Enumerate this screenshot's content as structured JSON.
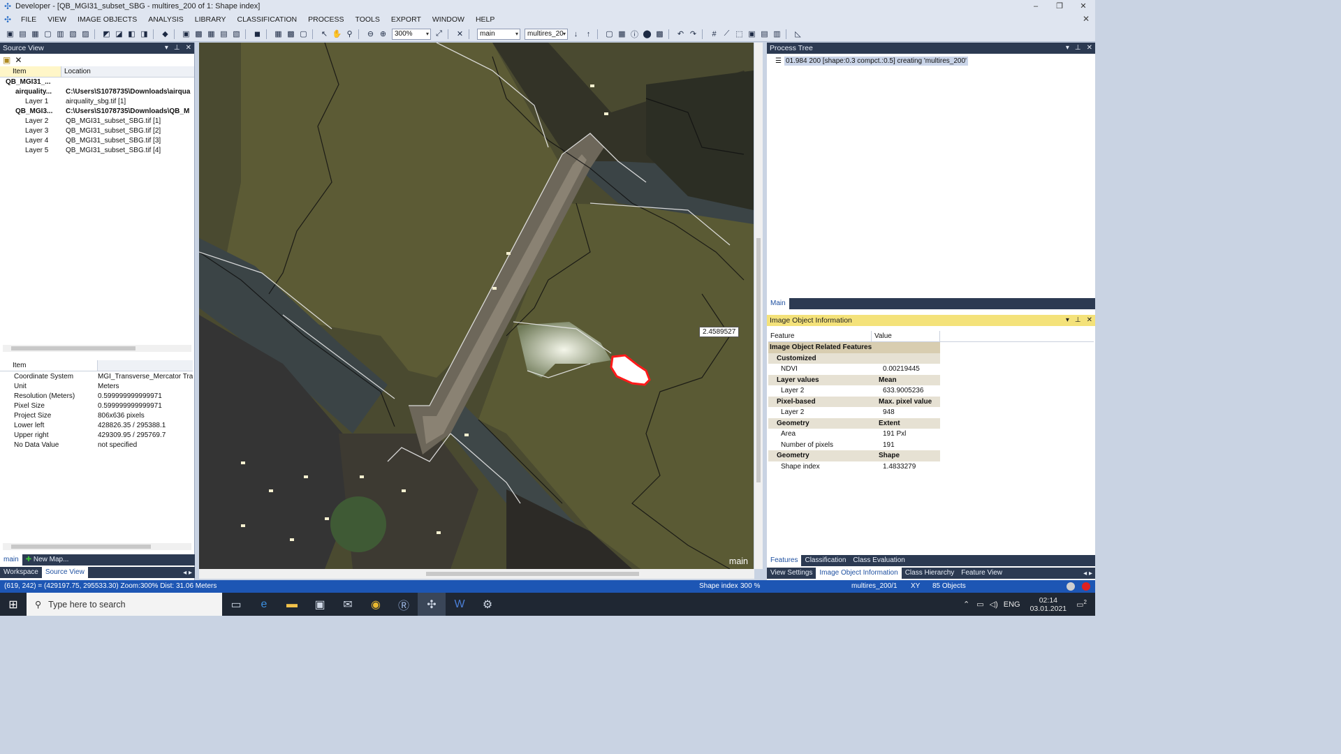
{
  "window": {
    "title": "Developer - [QB_MGI31_subset_SBG - multires_200 of 1: Shape index]",
    "controls": [
      "–",
      "❐",
      "✕"
    ]
  },
  "menu": [
    "FILE",
    "VIEW",
    "IMAGE OBJECTS",
    "ANALYSIS",
    "LIBRARY",
    "CLASSIFICATION",
    "PROCESS",
    "TOOLS",
    "EXPORT",
    "WINDOW",
    "HELP"
  ],
  "toolbar": {
    "zoom_value": "300%",
    "map_value": "main",
    "level_value": "multires_20"
  },
  "source_view": {
    "title": "Source View",
    "columns": [
      "Item",
      "Location"
    ],
    "rows": [
      {
        "item": "QB_MGI31_...",
        "location": "",
        "bold": true,
        "indent": 0
      },
      {
        "item": "airquality...",
        "location": "C:\\Users\\S1078735\\Downloads\\airqua",
        "bold": true,
        "indent": 1
      },
      {
        "item": "Layer 1",
        "location": "airquality_sbg.tif [1]",
        "bold": false,
        "indent": 2
      },
      {
        "item": "QB_MGI3...",
        "location": "C:\\Users\\S1078735\\Downloads\\QB_M",
        "bold": true,
        "indent": 1
      },
      {
        "item": "Layer 2",
        "location": "QB_MGI31_subset_SBG.tif [1]",
        "bold": false,
        "indent": 2
      },
      {
        "item": "Layer 3",
        "location": "QB_MGI31_subset_SBG.tif [2]",
        "bold": false,
        "indent": 2
      },
      {
        "item": "Layer 4",
        "location": "QB_MGI31_subset_SBG.tif [3]",
        "bold": false,
        "indent": 2
      },
      {
        "item": "Layer 5",
        "location": "QB_MGI31_subset_SBG.tif [4]",
        "bold": false,
        "indent": 2
      }
    ],
    "prop_header": "Item",
    "properties": [
      {
        "key": "Coordinate System",
        "value": "MGI_Transverse_Mercator  Trans"
      },
      {
        "key": "Unit",
        "value": "Meters"
      },
      {
        "key": "Resolution (Meters)",
        "value": "0.599999999999971"
      },
      {
        "key": "Pixel Size",
        "value": "0.599999999999971"
      },
      {
        "key": "Project Size",
        "value": "806x636 pixels"
      },
      {
        "key": "Lower left",
        "value": "428826.35 / 295388.1"
      },
      {
        "key": "Upper right",
        "value": "429309.95 / 295769.7"
      },
      {
        "key": "No Data Value",
        "value": "not specified"
      }
    ],
    "map_tabs": [
      "main",
      "New Map..."
    ],
    "bottom_tabs": [
      "Workspace",
      "Source View"
    ]
  },
  "viewer": {
    "tooltip": "2.4589527",
    "map_label": "main"
  },
  "process_tree": {
    "title": "Process Tree",
    "row": "01.984    200 [shape:0.3 compct.:0.5] creating 'multires_200'",
    "tab": "Main"
  },
  "image_object_info": {
    "title": "Image Object Information",
    "columns": [
      "Feature",
      "Value"
    ],
    "rows": [
      {
        "kind": "cat",
        "feature": "Image Object Related Features",
        "value": ""
      },
      {
        "kind": "grp",
        "feature": "Customized",
        "value": ""
      },
      {
        "kind": "val",
        "feature": "NDVI",
        "value": "0.00219445"
      },
      {
        "kind": "grp",
        "feature": "Layer values",
        "value": "Mean"
      },
      {
        "kind": "val",
        "feature": "Layer 2",
        "value": "633.9005236"
      },
      {
        "kind": "grp",
        "feature": "Pixel-based",
        "value": "Max. pixel value"
      },
      {
        "kind": "val",
        "feature": "Layer 2",
        "value": "948"
      },
      {
        "kind": "grp",
        "feature": "Geometry",
        "value": "Extent"
      },
      {
        "kind": "val",
        "feature": "Area",
        "value": "191 Pxl"
      },
      {
        "kind": "val",
        "feature": "Number of pixels",
        "value": "191"
      },
      {
        "kind": "grp",
        "feature": "Geometry",
        "value": "Shape"
      },
      {
        "kind": "val",
        "feature": "Shape index",
        "value": "1.4833279"
      }
    ],
    "tabs": [
      "Features",
      "Classification",
      "Class Evaluation"
    ],
    "bottom_tabs": [
      "View Settings",
      "Image Object Information",
      "Class Hierarchy",
      "Feature View"
    ]
  },
  "status": {
    "coords": "(619, 242) = (429197.75, 295533.30)  Zoom:300%  Dist: 31.06 Meters",
    "feature": "Shape index",
    "zoom": "300 %",
    "level": "multires_200/1",
    "xy": "XY",
    "objects": "85 Objects"
  },
  "taskbar": {
    "search_placeholder": "Type here to search",
    "lang": "ENG",
    "time": "02:14",
    "date": "03.01.2021",
    "notif_count": "2"
  }
}
